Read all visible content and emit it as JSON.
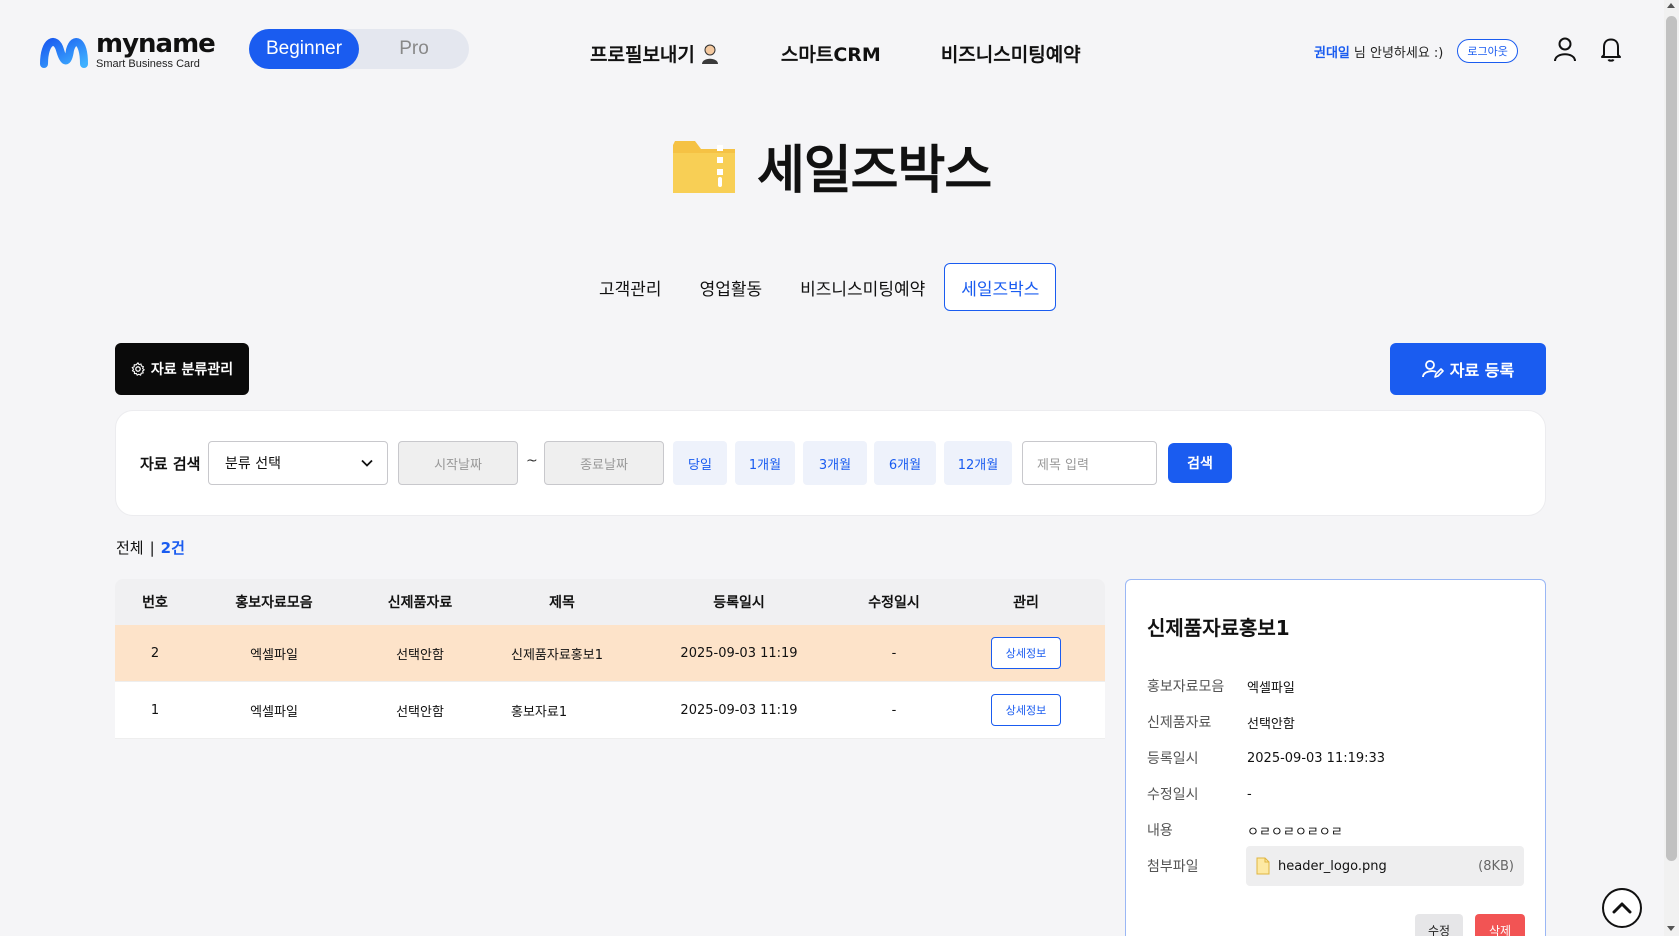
{
  "header": {
    "logo_name": "myname",
    "logo_sub": "Smart Business Card",
    "mode_toggle": {
      "beginner": "Beginner",
      "pro": "Pro"
    },
    "nav": [
      {
        "label": "프로필보내기"
      },
      {
        "label": "스마트CRM"
      },
      {
        "label": "비즈니스미팅예약"
      }
    ],
    "user_name": "권대일",
    "greeting": "님 안녕하세요 :)",
    "logout_label": "로그아웃"
  },
  "page": {
    "title": "세일즈박스"
  },
  "sub_tabs": [
    {
      "label": "고객관리",
      "active": false
    },
    {
      "label": "영업활동",
      "active": false
    },
    {
      "label": "비즈니스미팅예약",
      "active": false
    },
    {
      "label": "세일즈박스",
      "active": true
    }
  ],
  "actions": {
    "category_manage": "자료 분류관리",
    "register": "자료 등록"
  },
  "search": {
    "label": "자료 검색",
    "category_select": "분류 선택",
    "start_date_placeholder": "시작날짜",
    "tilde": "~",
    "end_date_placeholder": "종료날짜",
    "periods": [
      "당일",
      "1개월",
      "3개월",
      "6개월",
      "12개월"
    ],
    "title_placeholder": "제목 입력",
    "search_button": "검색"
  },
  "count": {
    "label": "전체",
    "separator": "|",
    "value": "2건"
  },
  "table": {
    "headers": [
      "번호",
      "홍보자료모음",
      "신제품자료",
      "제목",
      "등록일시",
      "수정일시",
      "관리"
    ],
    "rows": [
      {
        "no": "2",
        "group": "엑셀파일",
        "newproduct": "선택안함",
        "title": "신제품자료홍보1",
        "created": "2025-09-03 11:19",
        "modified": "-",
        "action": "상세정보",
        "selected": true
      },
      {
        "no": "1",
        "group": "엑셀파일",
        "newproduct": "선택안함",
        "title": "홍보자료1",
        "created": "2025-09-03 11:19",
        "modified": "-",
        "action": "상세정보",
        "selected": false
      }
    ]
  },
  "detail": {
    "title": "신제품자료홍보1",
    "fields": [
      {
        "label": "홍보자료모음",
        "value": "엑셀파일"
      },
      {
        "label": "신제품자료",
        "value": "선택안함"
      },
      {
        "label": "등록일시",
        "value": "2025-09-03 11:19:33"
      },
      {
        "label": "수정일시",
        "value": "-"
      },
      {
        "label": "내용",
        "value": "ㅇㄹㅇㄹㅇㄹㅇㄹ"
      }
    ],
    "attachment_label": "첨부파일",
    "attachment_name": "header_logo.png",
    "attachment_size": "(8KB)",
    "edit_label": "수정",
    "delete_label": "삭제"
  },
  "colors": {
    "accent": "#1a5cf0",
    "selected_row": "#fde3c9",
    "delete": "#f25454"
  }
}
